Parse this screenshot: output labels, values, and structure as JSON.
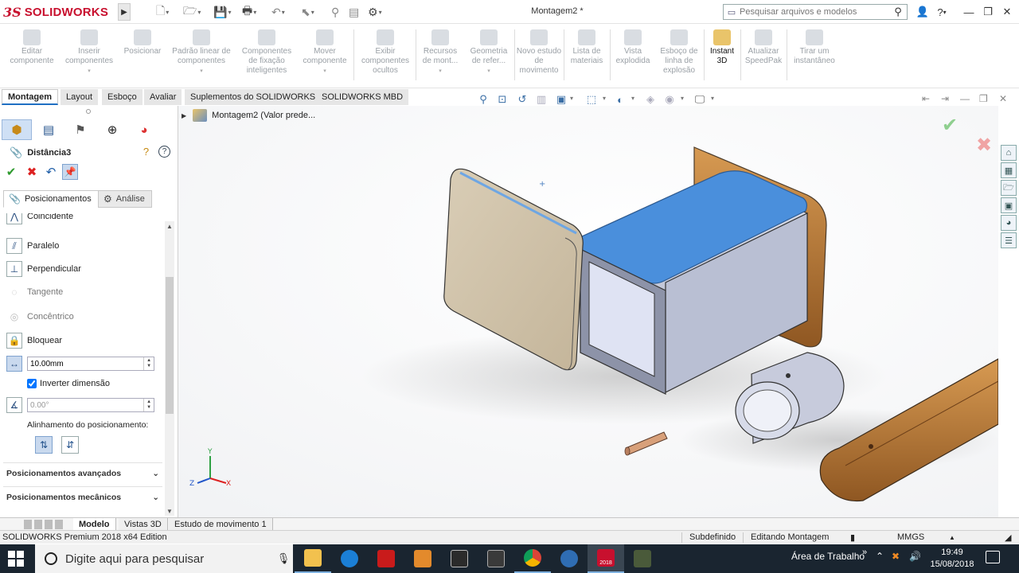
{
  "app": {
    "brand_mark": "3S",
    "brand_name": "SOLIDWORKS",
    "document_title": "Montagem2 *",
    "search_placeholder": "Pesquisar arquivos e modelos"
  },
  "command_manager": [
    {
      "label": "Editar componente",
      "enabled": false,
      "dropdown": false
    },
    {
      "label": "Inserir componentes",
      "enabled": false,
      "dropdown": true
    },
    {
      "label": "Posicionar",
      "enabled": false,
      "dropdown": false
    },
    {
      "label": "Padrão linear de componentes",
      "enabled": false,
      "dropdown": true
    },
    {
      "label": "Componentes de fixação inteligentes",
      "enabled": false,
      "dropdown": false
    },
    {
      "label": "Mover componente",
      "enabled": false,
      "dropdown": true
    },
    {
      "label": "Exibir componentes ocultos",
      "enabled": false,
      "dropdown": false
    },
    {
      "label": "Recursos de mont...",
      "enabled": false,
      "dropdown": true
    },
    {
      "label": "Geometria de refer...",
      "enabled": false,
      "dropdown": true
    },
    {
      "label": "Novo estudo de movimento",
      "enabled": false,
      "dropdown": false
    },
    {
      "label": "Lista de materiais",
      "enabled": false,
      "dropdown": false
    },
    {
      "label": "Vista explodida",
      "enabled": false,
      "dropdown": false
    },
    {
      "label": "Esboço de linha de explosão",
      "enabled": false,
      "dropdown": false
    },
    {
      "label": "Instant 3D",
      "enabled": true,
      "dropdown": false
    },
    {
      "label": "Atualizar SpeedPak",
      "enabled": false,
      "dropdown": false
    },
    {
      "label": "Tirar um instantâneo",
      "enabled": false,
      "dropdown": false
    }
  ],
  "tabs": [
    "Montagem",
    "Layout",
    "Esboço",
    "Avaliar",
    "Suplementos do SOLIDWORKS",
    "SOLIDWORKS MBD"
  ],
  "tree": {
    "root_label": "Montagem2  (Valor prede..."
  },
  "property_manager": {
    "title": "Distância3",
    "subtabs": [
      "Posicionamentos",
      "Análise"
    ],
    "mates": [
      {
        "label": "Coincidente",
        "enabled": true,
        "icon": "coincident-icon"
      },
      {
        "label": "Paralelo",
        "enabled": true,
        "icon": "parallel-icon"
      },
      {
        "label": "Perpendicular",
        "enabled": true,
        "icon": "perpendicular-icon"
      },
      {
        "label": "Tangente",
        "enabled": false,
        "icon": "tangent-icon"
      },
      {
        "label": "Concêntrico",
        "enabled": false,
        "icon": "concentric-icon"
      },
      {
        "label": "Bloquear",
        "enabled": true,
        "icon": "lock-icon"
      }
    ],
    "distance_value": "10.00mm",
    "flip_dimension_label": "Inverter dimensão",
    "flip_dimension_checked": true,
    "angle_value": "0.00°",
    "alignment_label": "Alinhamento do posicionamento:",
    "sections": [
      "Posicionamentos avançados",
      "Posicionamentos mecânicos"
    ]
  },
  "bottom_tabs": [
    "Modelo",
    "Vistas 3D",
    "Estudo de movimento 1"
  ],
  "status_bar": {
    "edition": "SOLIDWORKS Premium 2018 x64 Edition",
    "state": "Subdefinido",
    "mode": "Editando Montagem",
    "units": "MMGS"
  },
  "taskbar": {
    "search_placeholder": "Digite aqui para pesquisar",
    "desktop_label": "Área de Trabalho",
    "time": "19:49",
    "date": "15/08/2018",
    "sw_badge": "2018"
  },
  "colors": {
    "accent": "#1f6fc3",
    "brand": "#c8102e",
    "selected_face": "#4a8fdc",
    "wood": "#b87a3c",
    "taskbar": "#1a2530"
  }
}
